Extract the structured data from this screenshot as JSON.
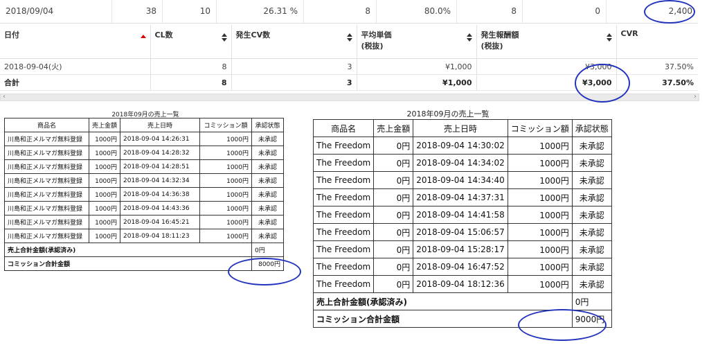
{
  "summary": {
    "date": "2018/09/04",
    "cells": [
      "38",
      "10",
      "26.31 %",
      "8",
      "80.0%",
      "8",
      "0",
      "2,400"
    ]
  },
  "report": {
    "headers": [
      "日付",
      "CL数",
      "発生CV数",
      "平均単価\n(税抜)",
      "発生報酬額\n(税抜)",
      "CVR"
    ],
    "rows": [
      {
        "date": "2018-09-04(火)",
        "cl": "8",
        "cv": "3",
        "avg": "¥1,000",
        "reward": "¥3,000",
        "cvr": "37.50%"
      }
    ],
    "total": {
      "label": "合計",
      "cl": "8",
      "cv": "3",
      "avg": "¥1,000",
      "reward": "¥3,000",
      "cvr": "37.50%"
    }
  },
  "scroll": {
    "left": "‹",
    "right": "›"
  },
  "sales_left": {
    "title": "2018年09月の売上一覧",
    "headers": [
      "商品名",
      "売上金額",
      "売上日時",
      "コミッション額",
      "承認状態"
    ],
    "rows": [
      [
        "川島和正メルマガ無料登録",
        "1000円",
        "2018-09-04 14:26:31",
        "1000円",
        "未承認"
      ],
      [
        "川島和正メルマガ無料登録",
        "1000円",
        "2018-09-04 14:28:32",
        "1000円",
        "未承認"
      ],
      [
        "川島和正メルマガ無料登録",
        "1000円",
        "2018-09-04 14:28:51",
        "1000円",
        "未承認"
      ],
      [
        "川島和正メルマガ無料登録",
        "1000円",
        "2018-09-04 14:32:34",
        "1000円",
        "未承認"
      ],
      [
        "川島和正メルマガ無料登録",
        "1000円",
        "2018-09-04 14:36:38",
        "1000円",
        "未承認"
      ],
      [
        "川島和正メルマガ無料登録",
        "1000円",
        "2018-09-04 14:43:36",
        "1000円",
        "未承認"
      ],
      [
        "川島和正メルマガ無料登録",
        "1000円",
        "2018-09-04 16:45:21",
        "1000円",
        "未承認"
      ],
      [
        "川島和正メルマガ無料登録",
        "1000円",
        "2018-09-04 18:11:23",
        "1000円",
        "未承認"
      ]
    ],
    "sales_total_label": "売上合計金額(承認済み)",
    "sales_total": "0円",
    "commission_total_label": "コミッション合計金額",
    "commission_total": "8000円"
  },
  "sales_right": {
    "title": "2018年09月の売上一覧",
    "headers": [
      "商品名",
      "売上金額",
      "売上日時",
      "コミッション額",
      "承認状態"
    ],
    "rows": [
      [
        "The Freedom",
        "0円",
        "2018-09-04 14:30:02",
        "1000円",
        "未承認"
      ],
      [
        "The Freedom",
        "0円",
        "2018-09-04 14:34:02",
        "1000円",
        "未承認"
      ],
      [
        "The Freedom",
        "0円",
        "2018-09-04 14:34:40",
        "1000円",
        "未承認"
      ],
      [
        "The Freedom",
        "0円",
        "2018-09-04 14:37:31",
        "1000円",
        "未承認"
      ],
      [
        "The Freedom",
        "0円",
        "2018-09-04 14:41:58",
        "1000円",
        "未承認"
      ],
      [
        "The Freedom",
        "0円",
        "2018-09-04 15:06:57",
        "1000円",
        "未承認"
      ],
      [
        "The Freedom",
        "0円",
        "2018-09-04 15:28:17",
        "1000円",
        "未承認"
      ],
      [
        "The Freedom",
        "0円",
        "2018-09-04 16:47:52",
        "1000円",
        "未承認"
      ],
      [
        "The Freedom",
        "0円",
        "2018-09-04 18:12:36",
        "1000円",
        "未承認"
      ]
    ],
    "sales_total_label": "売上合計金額(承認済み)",
    "sales_total": "0円",
    "commission_total_label": "コミッション合計金額",
    "commission_total": "9000円"
  },
  "annotation_color": "#2233bb"
}
